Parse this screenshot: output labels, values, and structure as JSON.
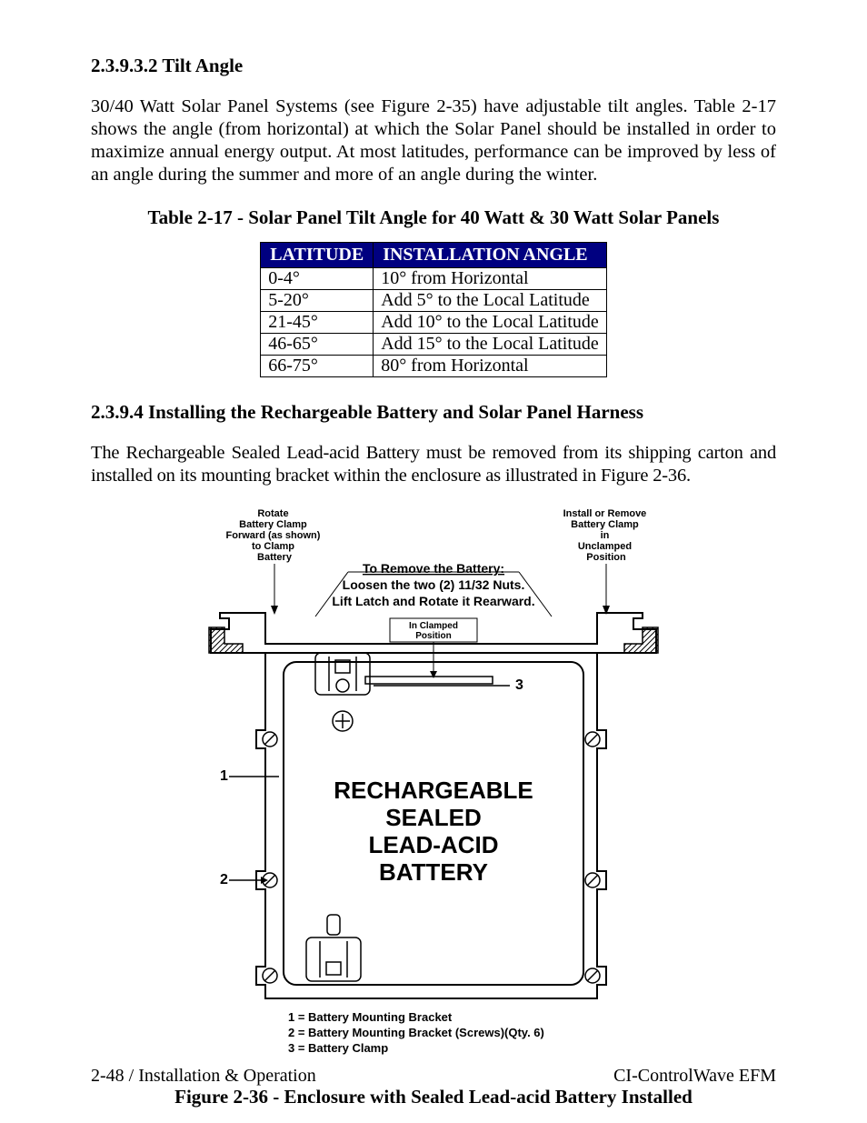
{
  "sections": {
    "tilt": {
      "heading": "2.3.9.3.2  Tilt Angle",
      "paragraph": "30/40 Watt Solar Panel Systems (see Figure 2-35) have adjustable tilt angles. Table 2-17 shows the angle (from horizontal) at which the Solar Panel should be installed in order to maximize annual energy output. At most latitudes, performance can be improved by less of an angle during the summer and more of an angle during the winter."
    },
    "battery": {
      "heading": "2.3.9.4  Installing the Rechargeable Battery and Solar Panel Harness",
      "paragraph": "The Rechargeable Sealed Lead-acid Battery must be removed from its shipping carton and installed on its mounting bracket within the enclosure as illustrated in Figure 2-36."
    }
  },
  "table": {
    "caption": "Table 2-17 - Solar Panel Tilt Angle for 40 Watt & 30 Watt Solar Panels",
    "headers": {
      "c1": "LATITUDE",
      "c2": "INSTALLATION ANGLE"
    },
    "rows": [
      {
        "lat": "0-4°",
        "angle": "10° from Horizontal"
      },
      {
        "lat": "5-20°",
        "angle": "Add 5° to the Local Latitude"
      },
      {
        "lat": "21-45°",
        "angle": "Add 10° to the Local Latitude"
      },
      {
        "lat": "46-65°",
        "angle": "Add 15° to the Local Latitude"
      },
      {
        "lat": "66-75°",
        "angle": "80° from Horizontal"
      }
    ]
  },
  "figure": {
    "caption": "Figure 2-36 - Enclosure with Sealed Lead-acid Battery Installed",
    "annotations": {
      "rotate_clamp": "Rotate\nBattery Clamp\nForward (as shown)\nto Clamp\nBattery",
      "install_remove_clamp": "Install or Remove\nBattery Clamp\nin\nUnclamped\nPosition",
      "remove_battery_title": "To Remove the Battery:",
      "remove_battery_l2": "Loosen the two (2) 11/32 Nuts.",
      "remove_battery_l3": "Lift Latch and Rotate it Rearward.",
      "in_clamped": "In Clamped\nPosition",
      "main_label": "RECHARGEABLE\nSEALED\nLEAD-ACID\nBATTERY",
      "callouts": {
        "c1": "1",
        "c2": "2",
        "c3": "3"
      },
      "legend": {
        "l1": "1 = Battery Mounting Bracket",
        "l2": "2 = Battery Mounting Bracket (Screws)(Qty. 6)",
        "l3": "3 = Battery Clamp"
      }
    }
  },
  "footer": {
    "left": "2-48 / Installation & Operation",
    "right": "CI-ControlWave EFM"
  }
}
